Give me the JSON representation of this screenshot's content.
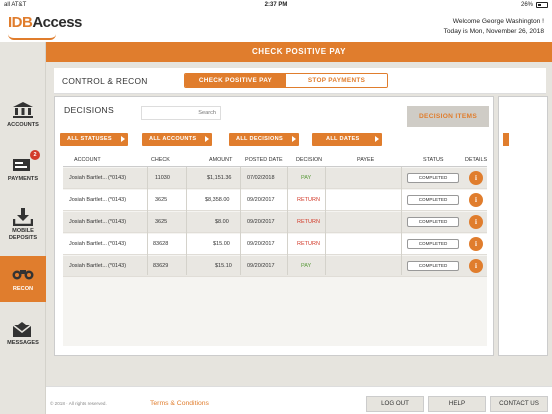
{
  "status_bar": {
    "carrier": "all AT&T",
    "time": "2:37 PM",
    "battery": "26%"
  },
  "header": {
    "logo_idb": "IDB",
    "logo_access": "Access",
    "welcome": "Welcome George Washington !",
    "today": "Today is Mon, November 26, 2018"
  },
  "banner": {
    "title": "CHECK POSITIVE PAY"
  },
  "sidebar": {
    "items": [
      {
        "label": "ACCOUNTS",
        "icon": "bank-icon"
      },
      {
        "label": "PAYMENTS",
        "icon": "payments-icon",
        "badge": "2"
      },
      {
        "label": "MOBILE DEPOSITS",
        "line1": "MOBILE",
        "line2": "DEPOSITS",
        "icon": "download-tray-icon"
      },
      {
        "label": "RECON",
        "icon": "binoculars-icon"
      },
      {
        "label": "MESSAGES",
        "icon": "envelope-icon"
      }
    ]
  },
  "main": {
    "section_title": "CONTROL & RECON",
    "tabs": [
      {
        "label": "CHECK POSITIVE PAY",
        "active": true
      },
      {
        "label": "STOP PAYMENTS",
        "active": false
      }
    ],
    "decisions_title": "DECISIONS",
    "search_placeholder": "Search",
    "decision_items_label": "DECISION ITEMS",
    "filters": [
      "ALL STATUSES",
      "ALL ACCOUNTS",
      "ALL DECISIONS",
      "ALL DATES"
    ],
    "columns": [
      "ACCOUNT",
      "CHECK",
      "AMOUNT",
      "POSTED DATE",
      "DECISION",
      "PAYEE",
      "STATUS",
      "DETAILS"
    ],
    "rows": [
      {
        "account": "Josiah Bartlet...",
        "acct_num": "(*0143)",
        "check": "11030",
        "amount": "$1,151.36",
        "posted": "07/02/2018",
        "decision": "PAY",
        "payee": "",
        "status": "COMPLETED",
        "details": "i"
      },
      {
        "account": "Josiah Bartlet...",
        "acct_num": "(*0143)",
        "check": "3625",
        "amount": "$8,358.00",
        "posted": "09/20/2017",
        "decision": "RETURN",
        "payee": "",
        "status": "COMPLETED",
        "details": "i"
      },
      {
        "account": "Josiah Bartlet...",
        "acct_num": "(*0143)",
        "check": "3625",
        "amount": "$8.00",
        "posted": "09/20/2017",
        "decision": "RETURN",
        "payee": "",
        "status": "COMPLETED",
        "details": "i"
      },
      {
        "account": "Josiah Bartlet...",
        "acct_num": "(*0143)",
        "check": "83628",
        "amount": "$15.00",
        "posted": "09/20/2017",
        "decision": "RETURN",
        "payee": "",
        "status": "COMPLETED",
        "details": "i"
      },
      {
        "account": "Josiah Bartlet...",
        "acct_num": "(*0143)",
        "check": "83629",
        "amount": "$15.10",
        "posted": "09/20/2017",
        "decision": "PAY",
        "payee": "",
        "status": "COMPLETED",
        "details": "i"
      }
    ]
  },
  "footer": {
    "copyright": "© 2018 · All rights reserved.",
    "terms": "Terms & Conditions",
    "logout": "LOG OUT",
    "help": "HELP",
    "contact": "CONTACT US"
  },
  "colors": {
    "accent": "#e07d2d",
    "pay": "#5a9a3a",
    "return": "#d23b2a",
    "sidebar_bg": "#e6e4de"
  }
}
